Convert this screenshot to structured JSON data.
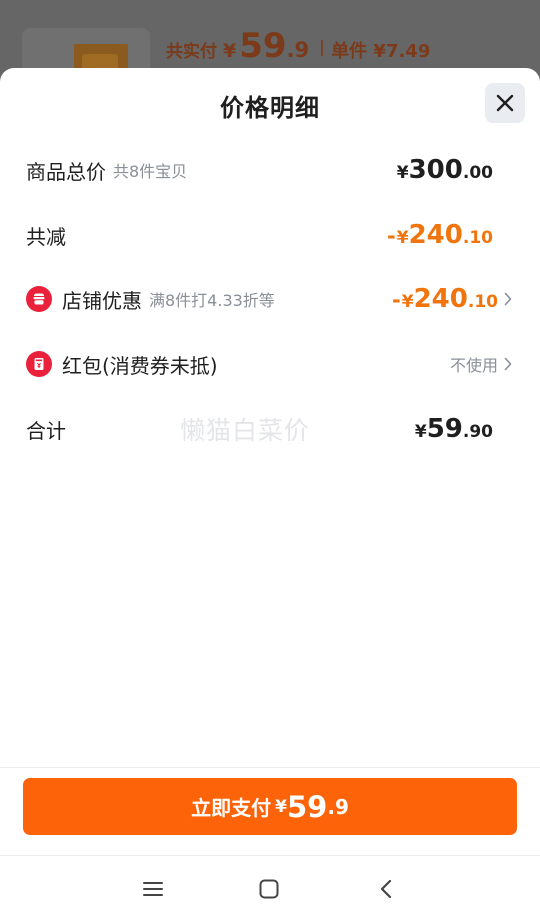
{
  "background": {
    "label": "共实付",
    "yen": "¥",
    "price_int": "59",
    "price_dec": ".9",
    "unit_label": "单件 ¥7.49"
  },
  "sheet": {
    "title": "价格明细"
  },
  "rows": {
    "total": {
      "label": "商品总价",
      "sub": "共8件宝贝",
      "yen": "¥",
      "int": "300",
      "dec": ".00"
    },
    "reduced": {
      "label": "共减",
      "sign": "-",
      "yen": "¥",
      "int": "240",
      "dec": ".10"
    },
    "shop_discount": {
      "label": "店铺优惠",
      "sub": "满8件打4.33折等",
      "sign": "-",
      "yen": "¥",
      "int": "240",
      "dec": ".10"
    },
    "red_packet": {
      "label": "红包(消费券未抵)",
      "value": "不使用"
    },
    "sum": {
      "label": "合计",
      "yen": "¥",
      "int": "59",
      "dec": ".90"
    }
  },
  "watermark": "懒猫白菜价",
  "pay_button": {
    "label": "立即支付",
    "yen": "¥",
    "int": "59",
    "dec": ".9"
  },
  "icons": {
    "close": "close-icon",
    "shop": "shop-icon",
    "red_packet": "red-packet-icon",
    "chevron": "chevron-right-icon",
    "nav_menu": "menu-icon",
    "nav_home": "home-icon",
    "nav_back": "back-icon"
  },
  "colors": {
    "accent": "#fd640a",
    "discount_text": "#f0750f",
    "icon_red": "#e9213b",
    "muted_text": "#8a8f99"
  }
}
